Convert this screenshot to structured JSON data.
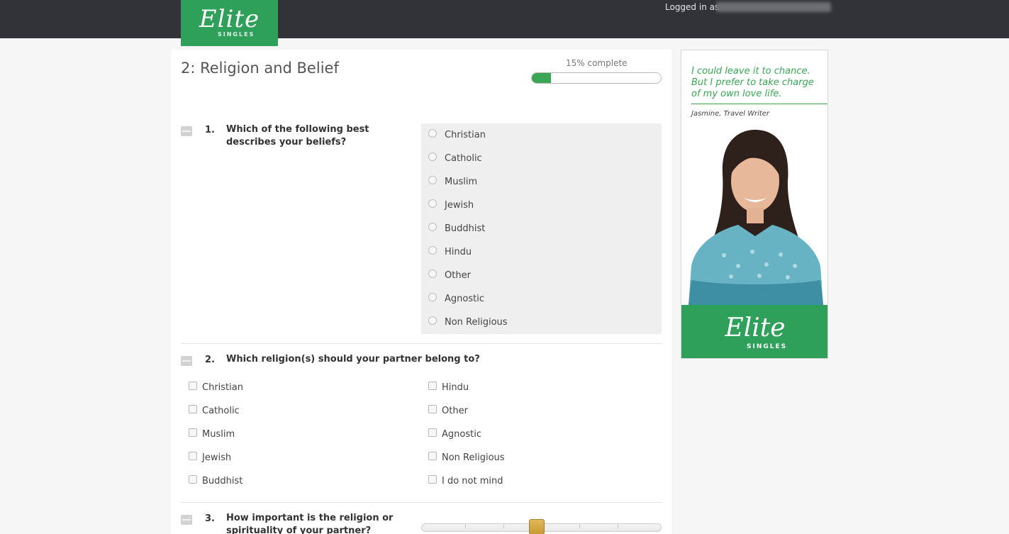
{
  "header": {
    "logo_text": "Elite",
    "logo_sub": "SINGLES",
    "logged_in_label": "Logged in as"
  },
  "page": {
    "section_title": "2: Religion and Belief",
    "progress_label": "15% complete",
    "progress_value": 0.15
  },
  "questions": [
    {
      "number": "1.",
      "text": "Which of the following best describes your beliefs?",
      "type": "radio",
      "options": [
        "Christian",
        "Catholic",
        "Muslim",
        "Jewish",
        "Buddhist",
        "Hindu",
        "Other",
        "Agnostic",
        "Non Religious"
      ]
    },
    {
      "number": "2.",
      "text": "Which religion(s) should your partner belong to?",
      "type": "checkbox",
      "options_left": [
        "Christian",
        "Catholic",
        "Muslim",
        "Jewish",
        "Buddhist"
      ],
      "options_right": [
        "Hindu",
        "Other",
        "Agnostic",
        "Non Religious",
        "I do not mind"
      ]
    },
    {
      "number": "3.",
      "text": "How important is the religion or spirituality of your partner?",
      "type": "slider",
      "value_fraction": 0.5
    }
  ],
  "ad": {
    "quote": "I could leave it to chance. But I prefer to take charge of my own love life.",
    "attribution": "Jasmine, Travel Writer",
    "brand_text": "Elite",
    "brand_sub": "SINGLES"
  },
  "colors": {
    "topbar": "#313339",
    "brand_green": "#2ea05a",
    "progress_fill": "#3aa655",
    "slider_thumb": "#d4a947"
  }
}
